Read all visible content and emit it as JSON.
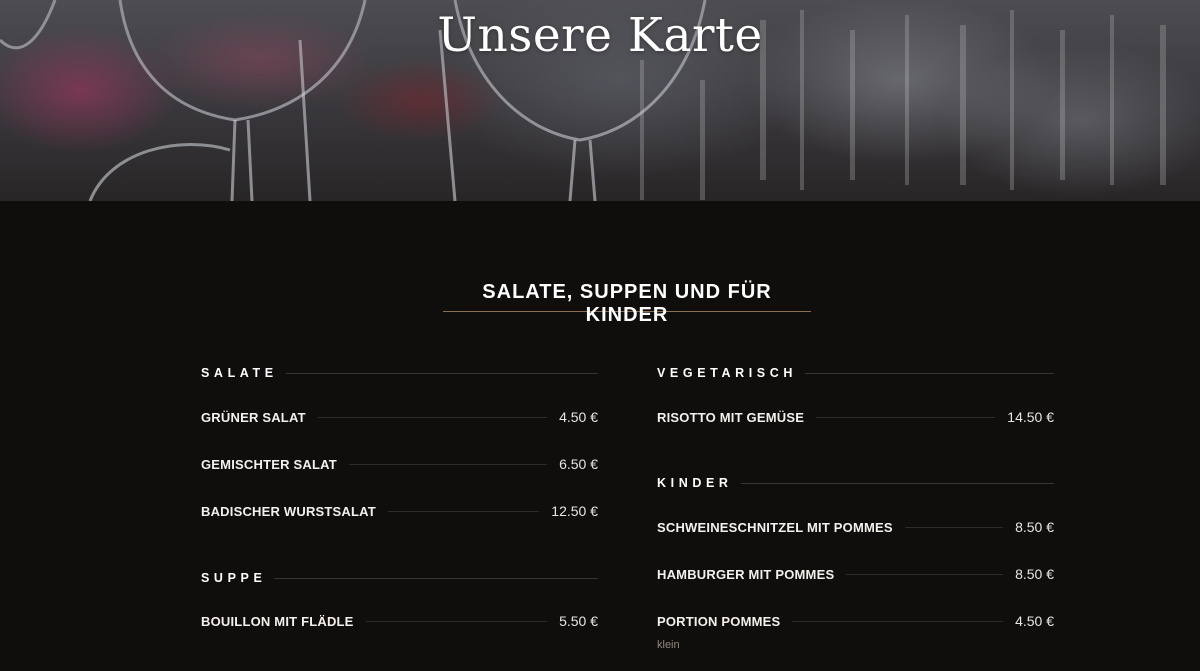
{
  "hero": {
    "title": "Unsere Karte"
  },
  "section": {
    "title": "SALATE, SUPPEN UND FÜR KINDER"
  },
  "left_column": {
    "categories": [
      {
        "title": "SALATE",
        "items": [
          {
            "name": "GRÜNER SALAT",
            "price": "4.50 €"
          },
          {
            "name": "GEMISCHTER SALAT",
            "price": "6.50 €"
          },
          {
            "name": "BADISCHER WURSTSALAT",
            "price": "12.50 €"
          }
        ]
      },
      {
        "title": "SUPPE",
        "items": [
          {
            "name": "BOUILLON MIT FLÄDLE",
            "price": "5.50 €"
          }
        ]
      }
    ]
  },
  "right_column": {
    "categories": [
      {
        "title": "VEGETARISCH",
        "items": [
          {
            "name": "RISOTTO MIT GEMÜSE",
            "price": "14.50 €"
          }
        ]
      },
      {
        "title": "KINDER",
        "items": [
          {
            "name": "SCHWEINESCHNITZEL MIT POMMES",
            "price": "8.50 €"
          },
          {
            "name": "HAMBURGER MIT POMMES",
            "price": "8.50 €"
          },
          {
            "name": "PORTION POMMES",
            "price": "4.50 €",
            "note": "klein"
          }
        ]
      }
    ]
  },
  "colors": {
    "background": "#100e0c",
    "heading_underline": "#8a6f55",
    "text": "#f4f1ec"
  }
}
